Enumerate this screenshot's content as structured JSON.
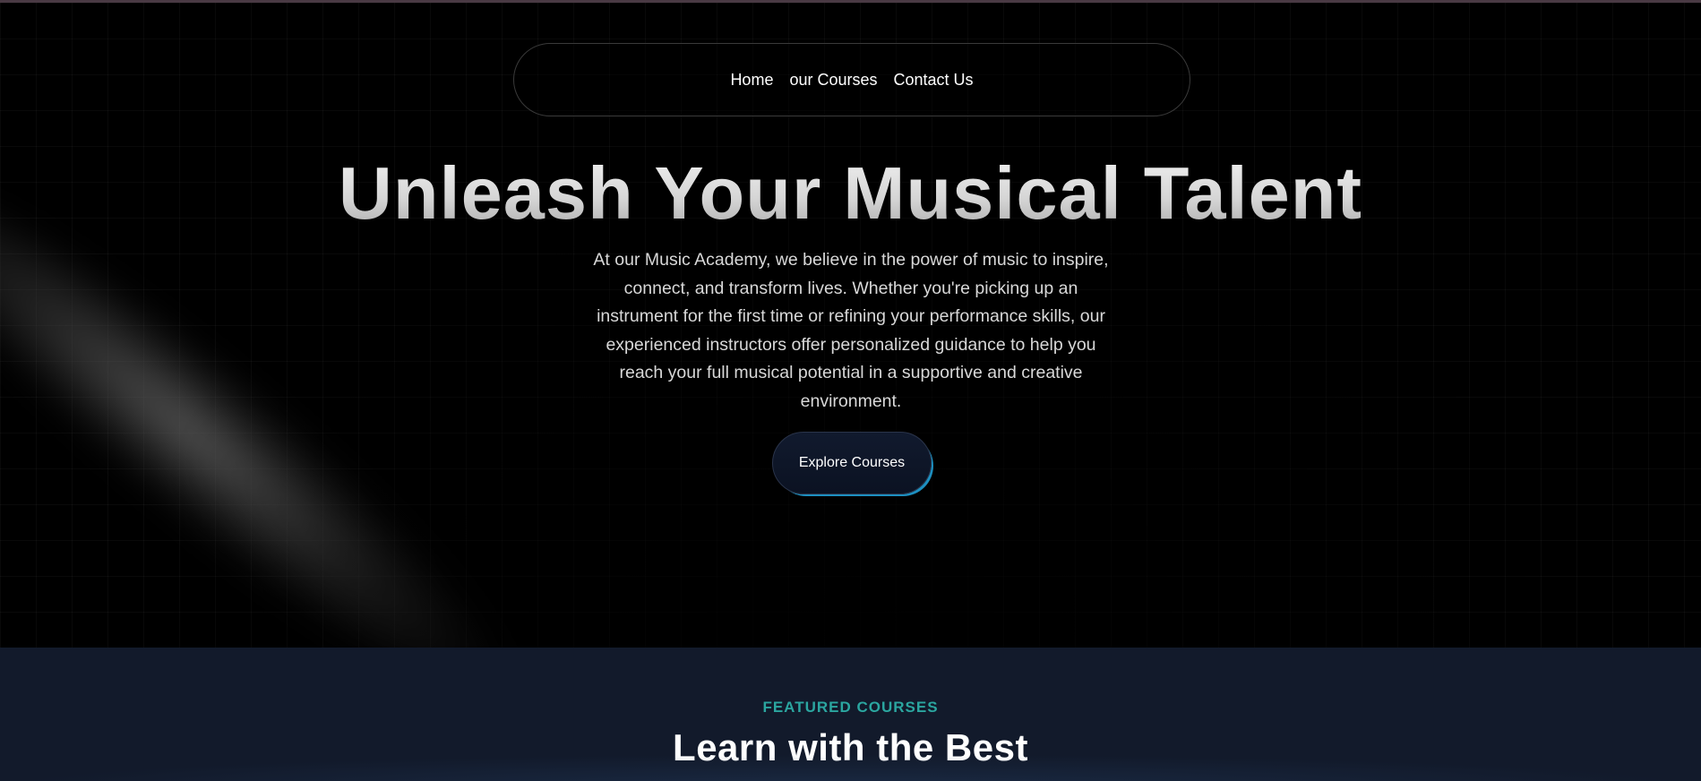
{
  "nav": {
    "items": [
      {
        "label": "Home"
      },
      {
        "label": "our Courses"
      },
      {
        "label": "Contact Us"
      }
    ]
  },
  "hero": {
    "headline": "Unleash Your Musical Talent",
    "intro": "At our Music Academy, we believe in the power of music to inspire, connect, and transform lives. Whether you're picking up an instrument for the first time or refining your performance skills, our experienced instructors offer personalized guidance to help you reach your full musical potential in a supportive and creative environment.",
    "cta_label": "Explore Courses"
  },
  "featured": {
    "eyebrow": "FEATURED COURSES",
    "title": "Learn with the Best"
  },
  "colors": {
    "background": "#000000",
    "section_background": "#121a2b",
    "accent_teal": "#2ba6a0",
    "button_glow": "#1d8fc0"
  }
}
